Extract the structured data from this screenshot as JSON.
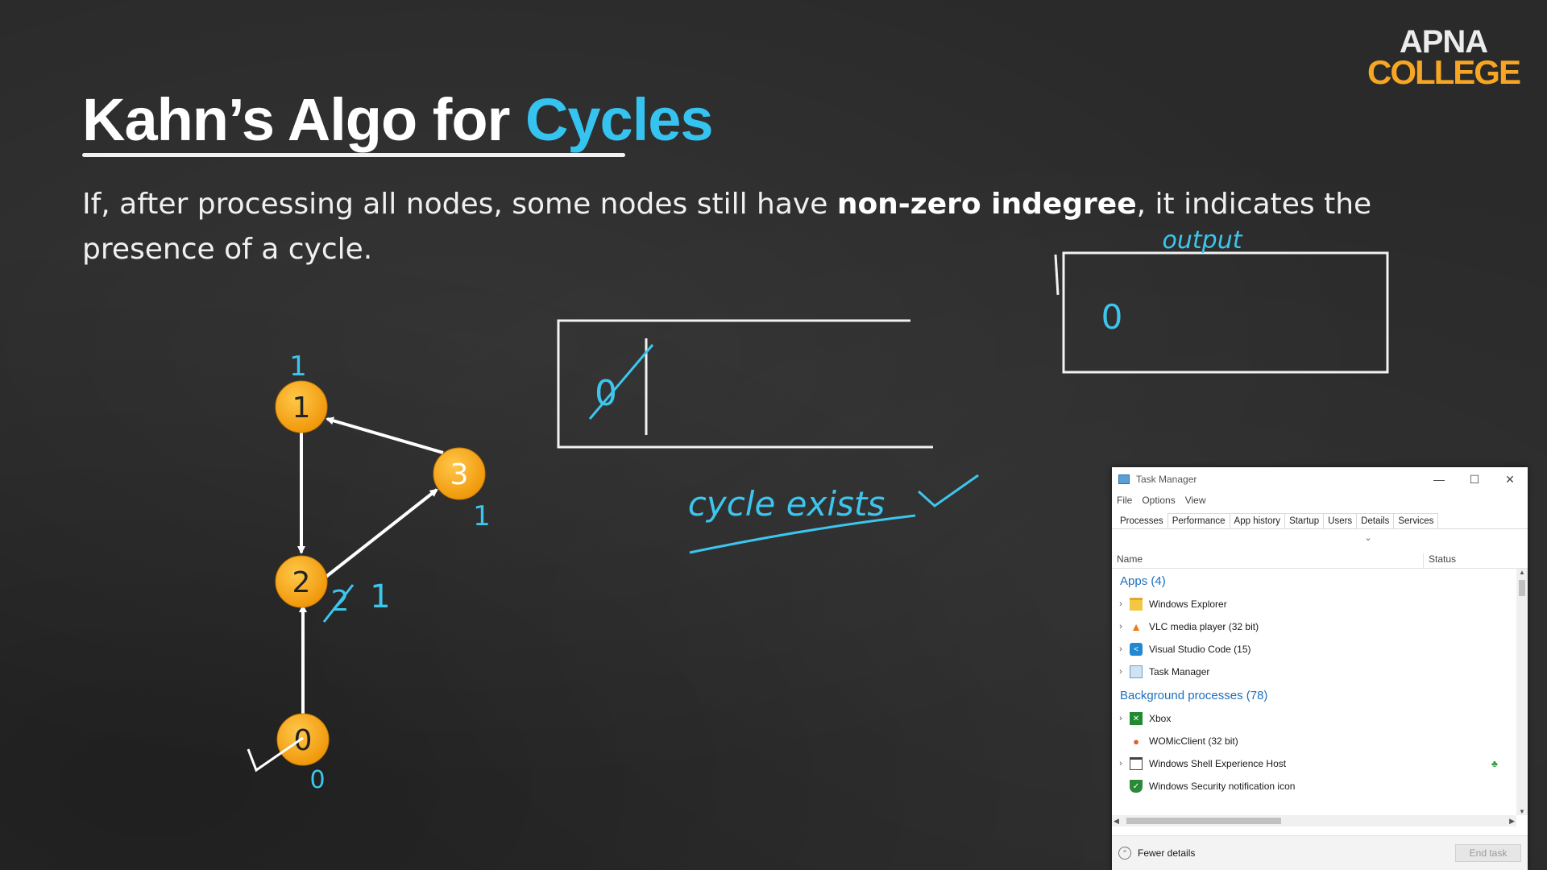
{
  "logo": {
    "line1": "APNA",
    "line2": "COLLEGE"
  },
  "title": {
    "main": "Kahn’s Algo for ",
    "accent": "Cycles"
  },
  "subtitle": {
    "before": "If, after processing all nodes, some nodes still have ",
    "bold": "non-zero indegree",
    "after": ", it indicates the presence of a cycle."
  },
  "graph": {
    "nodes": [
      "1",
      "2",
      "3",
      "0"
    ],
    "indegree_notes": {
      "node1": "1",
      "node3": "1",
      "node2_struck": "2",
      "node2": "1",
      "node0": "0"
    }
  },
  "queue_box": {
    "entry": "0"
  },
  "output_box": {
    "label": "output",
    "entry": "0"
  },
  "conclusion": "cycle exists",
  "colors": {
    "node_fill": "#f6a81c",
    "accent": "#35c4f0",
    "handwriting": "#3cc6ee",
    "logo_orange": "#f6a623"
  },
  "task_manager": {
    "title": "Task Manager",
    "menu": [
      "File",
      "Options",
      "View"
    ],
    "tabs": [
      "Processes",
      "Performance",
      "App history",
      "Startup",
      "Users",
      "Details",
      "Services"
    ],
    "active_tab": "Processes",
    "columns": {
      "name": "Name",
      "status": "Status"
    },
    "groups": [
      {
        "label": "Apps (4)",
        "items": [
          {
            "name": "Windows Explorer",
            "icon": "folder-icon",
            "expandable": true
          },
          {
            "name": "VLC media player (32 bit)",
            "icon": "vlc-cone-icon",
            "expandable": true
          },
          {
            "name": "Visual Studio Code (15)",
            "icon": "vscode-icon",
            "expandable": true
          },
          {
            "name": "Task Manager",
            "icon": "task-manager-icon",
            "expandable": true
          }
        ]
      },
      {
        "label": "Background processes (78)",
        "items": [
          {
            "name": "Xbox",
            "icon": "xbox-icon",
            "expandable": true
          },
          {
            "name": "WOMicClient (32 bit)",
            "icon": "microphone-icon",
            "expandable": false
          },
          {
            "name": "Windows Shell Experience Host",
            "icon": "window-icon",
            "expandable": true,
            "leaf": true
          },
          {
            "name": "Windows Security notification icon",
            "icon": "shield-icon",
            "expandable": false
          }
        ]
      }
    ],
    "footer": {
      "fewer_details": "Fewer details",
      "end_task": "End task"
    }
  }
}
